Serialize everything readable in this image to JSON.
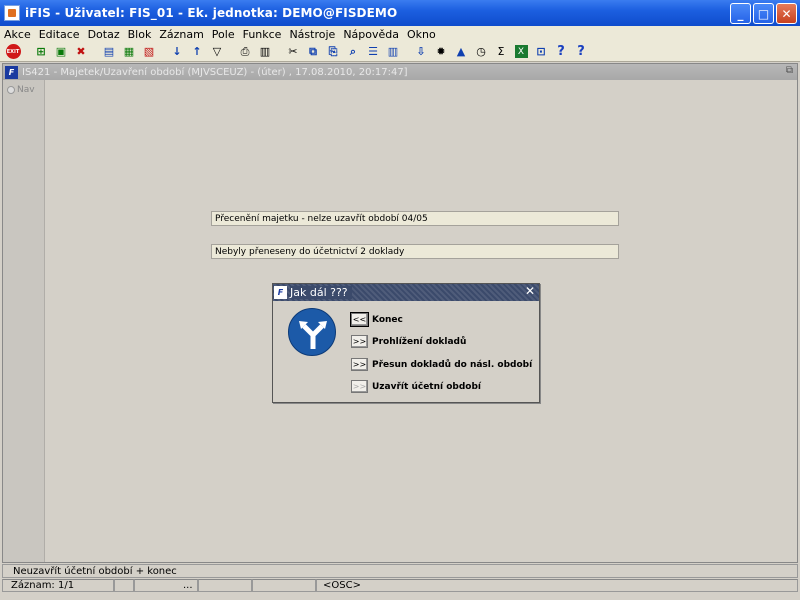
{
  "window": {
    "title": "iFIS - Uživatel: FIS_01 - Ek. jednotka: DEMO@FISDEMO"
  },
  "menu": [
    "Akce",
    "Editace",
    "Dotaz",
    "Blok",
    "Záznam",
    "Pole",
    "Funkce",
    "Nástroje",
    "Nápověda",
    "Okno"
  ],
  "toolbar": {
    "exit_label": "EXIT"
  },
  "form": {
    "title": "IS421 - Majetek/Uzavření období (MJVSCEUZ) - (úter) , 17.08.2010, 20:17:47]",
    "nav_label": "Nav",
    "message1": "Přecenění majetku - nelze uzavřít období 04/05",
    "message2": "Nebyly přeneseny do účetnictví 2 doklady"
  },
  "dialog": {
    "title": "Jak dál ???",
    "options": [
      {
        "button": "<<",
        "label": "Konec"
      },
      {
        "button": ">>",
        "label": "Prohlížení dokladů"
      },
      {
        "button": ">>",
        "label": "Přesun dokladů do násl. období"
      },
      {
        "button": ">>",
        "label": "Uzavřít účetní období"
      }
    ]
  },
  "status": {
    "hint": "Neuzavřít účetní období + konec",
    "record": "Záznam: 1/1",
    "ellipsis": "...",
    "osc": "<OSC>"
  }
}
